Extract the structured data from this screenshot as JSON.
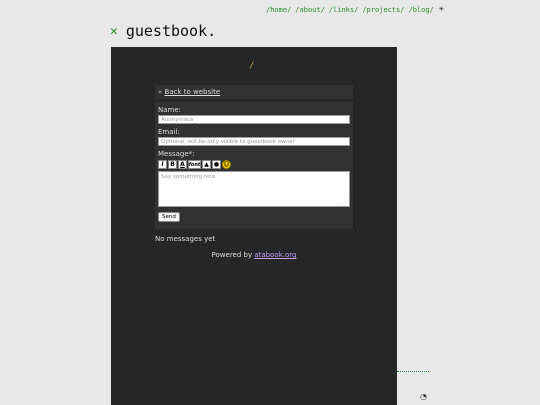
{
  "nav": {
    "links": [
      "/home/",
      "/about/",
      "/links/",
      "/projects/",
      "/blog/"
    ],
    "theme_icon": "sun-icon"
  },
  "header": {
    "title": "guestbook.",
    "mark_icon": "close-x-icon"
  },
  "guestbook": {
    "back_arrow": "«",
    "back_link": "Back to website",
    "name_label": "Name:",
    "name_placeholder": "Anonymous",
    "email_label": "Email:",
    "email_placeholder": "Optional, will be only visible to guestbook owner",
    "message_label": "Message*:",
    "toolbar": [
      "I",
      "B",
      "A",
      "font"
    ],
    "message_placeholder": "Say something nice",
    "send_label": "Send",
    "no_messages": "No messages yet",
    "powered_prefix": "Powered by",
    "powered_link": "atabook.org"
  },
  "colors": {
    "accent": "#2e8b2e",
    "frame_bg": "#242627",
    "page_bg": "#e8e8e8"
  }
}
